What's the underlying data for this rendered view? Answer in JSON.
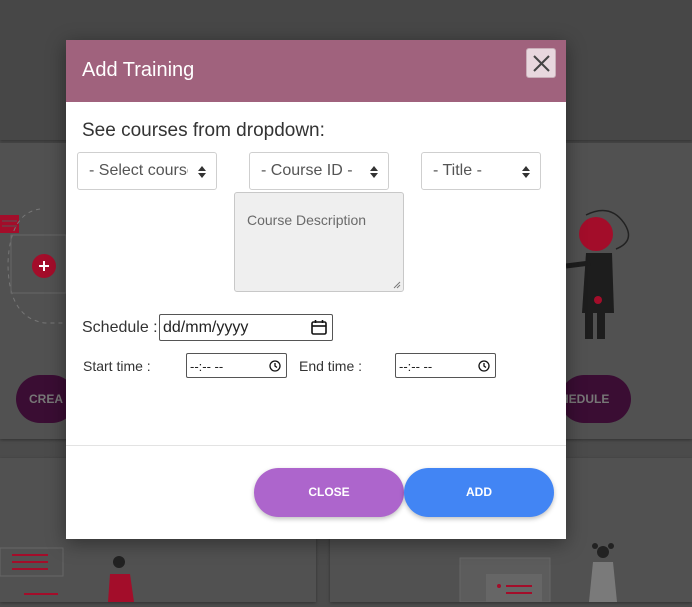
{
  "modal": {
    "title": "Add Training",
    "section_label": "See courses from dropdown:",
    "select_course": "- Select course -",
    "select_course_id": "- Course ID -",
    "select_title": "- Title -",
    "description_placeholder": "Course Description",
    "schedule_label": "Schedule :",
    "schedule_value": "dd/mm/yyyy",
    "start_time_label": "Start time :",
    "start_time_value": "--:-- --",
    "end_time_label": "End time :",
    "end_time_value": "--:-- --",
    "close_button": "CLOSE",
    "add_button": "ADD"
  },
  "background": {
    "left_button": "CREA",
    "right_button": "HEDULE"
  },
  "colors": {
    "header": "#a0627d",
    "close_button": "#ad65cc",
    "add_button": "#4285f4",
    "accent_red": "#c8102e"
  }
}
